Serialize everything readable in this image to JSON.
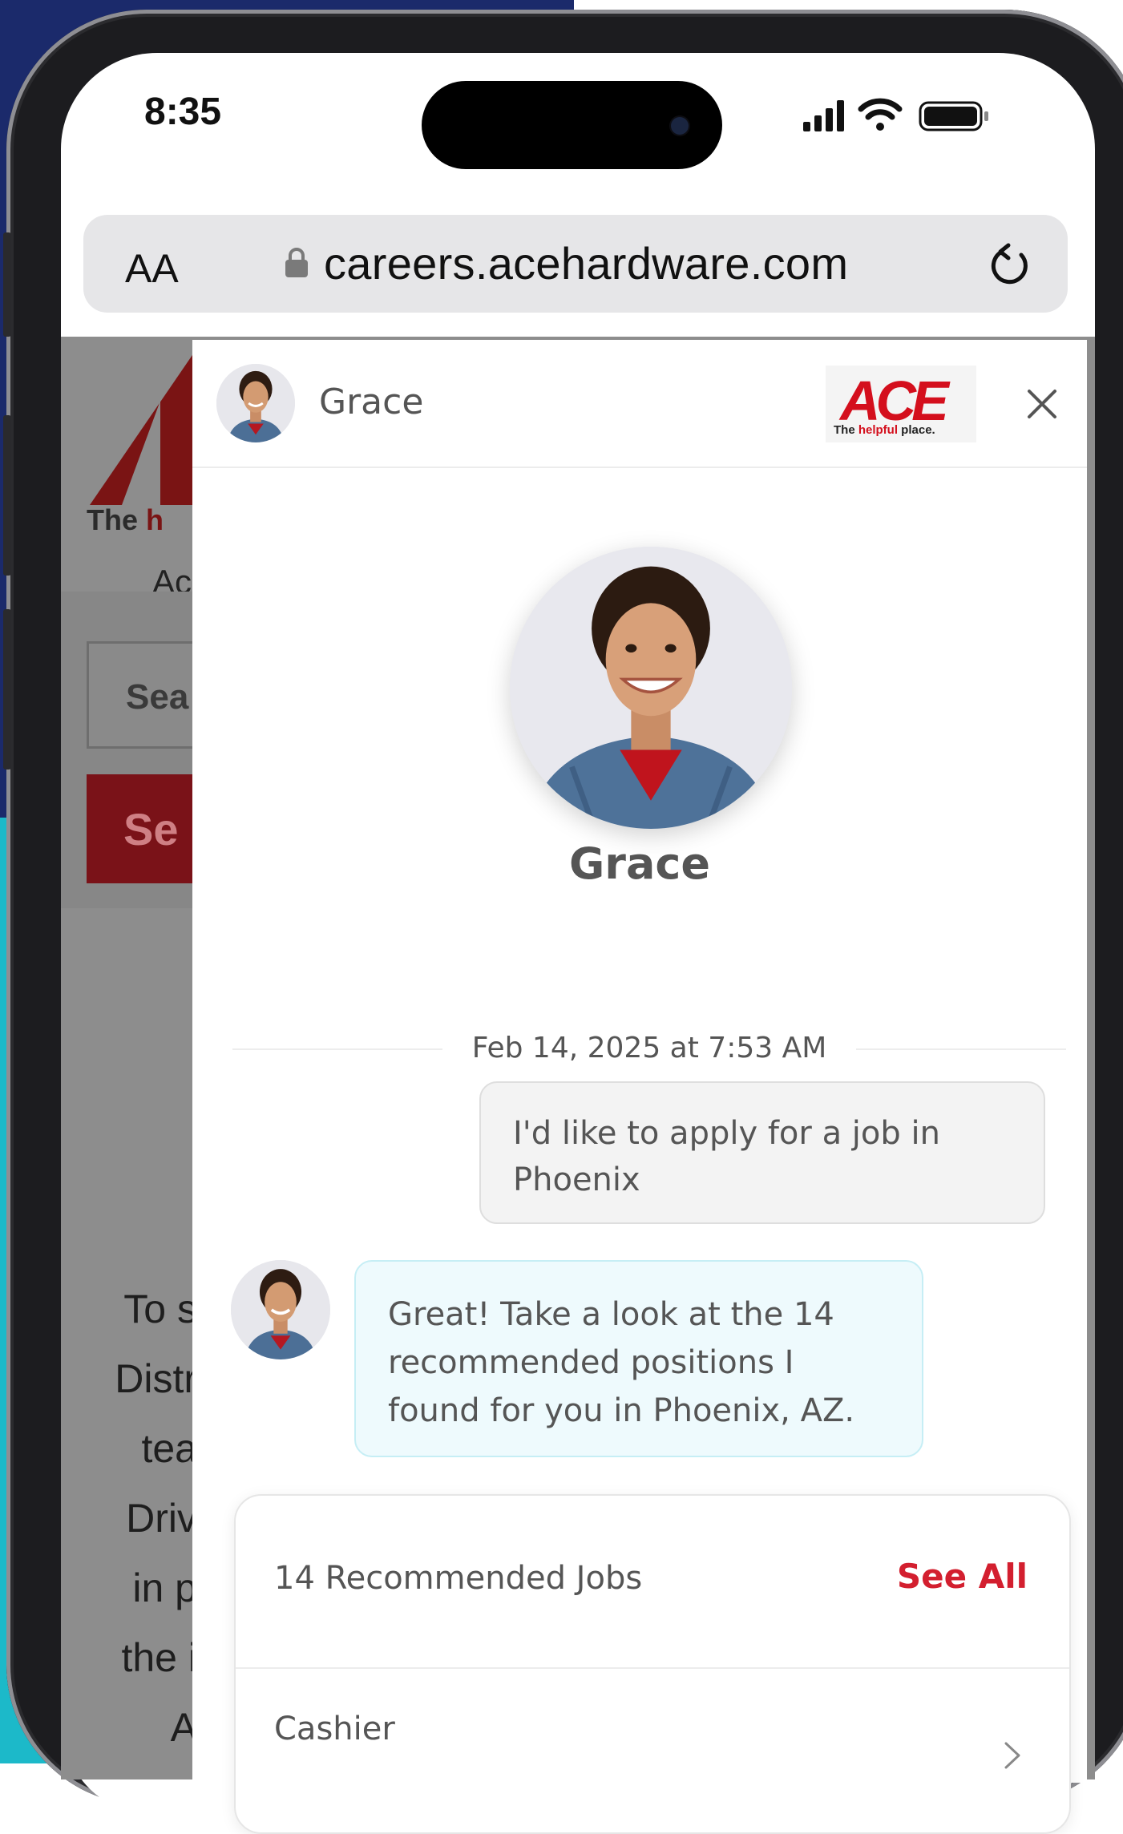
{
  "status_bar": {
    "time": "8:35"
  },
  "browser": {
    "text_size_label": "AA",
    "url": "careers.acehardware.com"
  },
  "background_page": {
    "tagline_start": "The",
    "tagline_red": "h",
    "heading_fragment": "Ac",
    "search_input_fragment": "Sea",
    "search_button_fragment": "Se",
    "body_lines": [
      "To s",
      "Distr",
      "tea",
      "Driv",
      "in p",
      "the i",
      "A"
    ]
  },
  "chat": {
    "header_name": "Grace",
    "brand": {
      "logo_text": "ACE",
      "tagline_pre": "The ",
      "tagline_red": "helpful",
      "tagline_post": " place."
    },
    "assistant_name": "Grace",
    "timestamp": "Feb 14, 2025 at 7:53 AM",
    "messages": [
      {
        "from": "user",
        "text": "I'd like to apply for a job in Phoenix"
      },
      {
        "from": "bot",
        "text": "Great! Take a look at the 14 recommended positions I found for you in Phoenix, AZ."
      }
    ],
    "jobs_card": {
      "title": "14 Recommended Jobs",
      "see_all_label": "See All",
      "jobs": [
        {
          "title": "Cashier"
        }
      ]
    }
  },
  "colors": {
    "ace_red": "#d40f1d",
    "see_all_red": "#d31f2f",
    "bot_bubble_bg": "#eefafd",
    "user_bubble_bg": "#f3f3f3",
    "background_navy": "#1b2a6b",
    "background_teal": "#1cb9c9"
  },
  "icons": [
    "lock-icon",
    "reload-icon",
    "close-icon",
    "chevron-right-icon",
    "signal-icon",
    "wifi-icon",
    "battery-icon"
  ]
}
